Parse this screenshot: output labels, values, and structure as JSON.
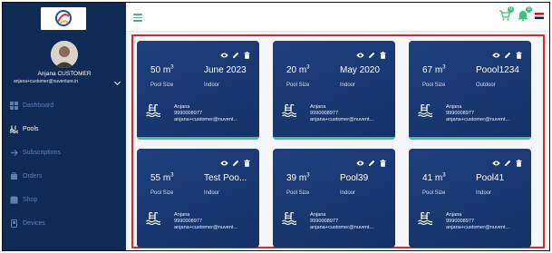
{
  "user": {
    "name": "Anjana CUSTOMER",
    "email": "anjana+customer@nuventure.in"
  },
  "nav": [
    {
      "label": "Dashboard",
      "icon": "dashboard-icon",
      "active": false
    },
    {
      "label": "Pools",
      "icon": "pool-icon",
      "active": true
    },
    {
      "label": "Subscriptions",
      "icon": "subscriptions-icon",
      "active": false
    },
    {
      "label": "Orders",
      "icon": "orders-icon",
      "active": false
    },
    {
      "label": "Shop",
      "icon": "shop-icon",
      "active": false
    },
    {
      "label": "Devices",
      "icon": "devices-icon",
      "active": false
    }
  ],
  "topbar": {
    "cart_badge": "0",
    "notify_badge": "0"
  },
  "labels": {
    "pool_size": "Pool Size",
    "unit": "m",
    "unit_exp": "3"
  },
  "pools": [
    {
      "size": "50",
      "name": "June 2023",
      "type": "Indoor",
      "owner": "Anjana",
      "phone": "9990008977",
      "email": "anjana+customer@nuvent..."
    },
    {
      "size": "20",
      "name": "May 2020",
      "type": "Indoor",
      "owner": "Anjana",
      "phone": "9990008977",
      "email": "anjana+customer@nuvent..."
    },
    {
      "size": "67",
      "name": "Poool1234",
      "type": "Outdoor",
      "owner": "Anjana",
      "phone": "9990008977",
      "email": "anjana+customer@nuvent..."
    },
    {
      "size": "55",
      "name": "Test Poo...",
      "type": "Indoor",
      "owner": "Anjana",
      "phone": "9990008977",
      "email": "anjana+customer@nuvent..."
    },
    {
      "size": "39",
      "name": "Pool39",
      "type": "Indoor",
      "owner": "Anjana",
      "phone": "9990008977",
      "email": "anjana+customer@nuvent..."
    },
    {
      "size": "41",
      "name": "Pool41",
      "type": "Indoor",
      "owner": "Anjana",
      "phone": "9990008977",
      "email": "anjana+customer@nuvent..."
    }
  ],
  "colors": {
    "sidebar": "#102a56",
    "card": "#1a3a78",
    "accent": "#39c98a",
    "highlight": "#d8282c"
  }
}
